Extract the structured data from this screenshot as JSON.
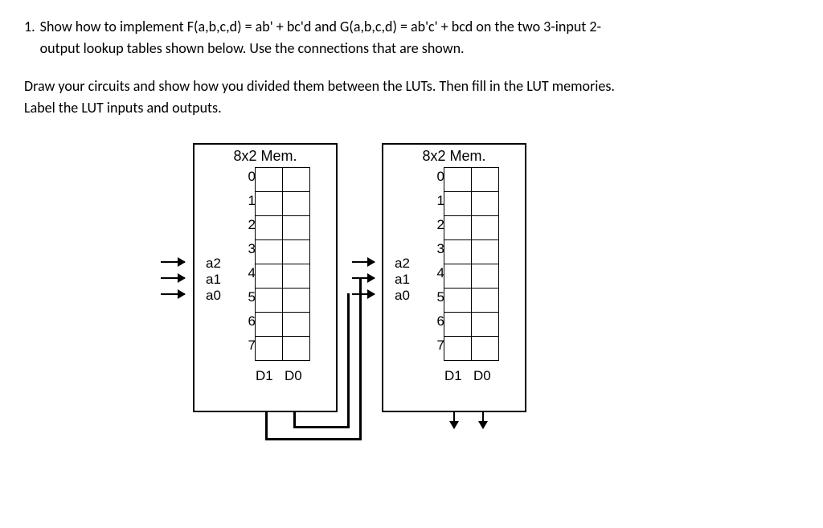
{
  "question": {
    "number": "1.",
    "text_line1": "Show how to implement F(a,b,c,d) = ab' + bc'd and G(a,b,c,d) = ab'c' + bcd on the two 3-input 2-",
    "text_line2": "output lookup tables shown below. Use the connections that are shown."
  },
  "instruction": {
    "line1": "Draw your circuits and show how you divided them between the LUTs. Then fill in the LUT memories.",
    "line2": "Label the LUT inputs and outputs."
  },
  "lut": {
    "title": "8x2 Mem.",
    "rows": [
      "0",
      "1",
      "2",
      "3",
      "4",
      "5",
      "6",
      "7"
    ],
    "inputs": [
      "a2",
      "a1",
      "a0"
    ],
    "outputs": [
      "D1",
      "D0"
    ]
  }
}
